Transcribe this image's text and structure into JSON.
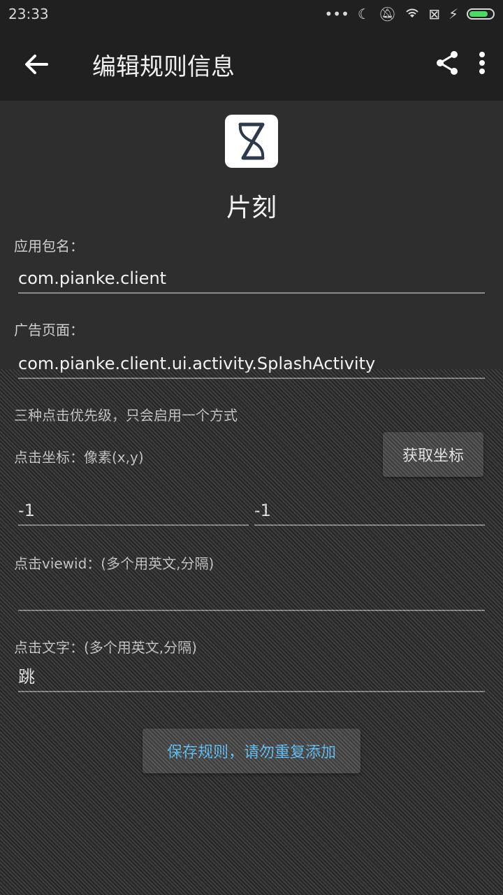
{
  "status_bar": {
    "time": "23:33",
    "icons": [
      "more-dots-icon",
      "moon-icon",
      "bell-off-icon",
      "wifi-icon",
      "sim-x-icon",
      "charging-icon",
      "battery-icon"
    ]
  },
  "app_bar": {
    "title": "编辑规则信息",
    "icons": [
      "back-arrow-icon",
      "share-icon",
      "more-vert-icon"
    ]
  },
  "app": {
    "name": "片刻",
    "icon": "hourglass-logo-icon"
  },
  "form": {
    "package_label": "应用包名：",
    "package_value": "com.pianke.client",
    "ad_page_label": "广告页面：",
    "ad_page_value": "com.pianke.client.ui.activity.SplashActivity",
    "hint": "三种点击优先级，只会启用一个方式",
    "coord_label": "点击坐标：像素(x,y)",
    "coord_button": "获取坐标",
    "x_value": "-1",
    "y_value": "-1",
    "viewid_label": "点击viewid：(多个用英文,分隔)",
    "viewid_value": "",
    "text_label": "点击文字：(多个用英文,分隔)",
    "text_value": "跳",
    "save_button": "保存规则，请勿重复添加"
  },
  "colors": {
    "background": "#2e2e2e",
    "app_bar": "#202020",
    "accent": "#62c8ff",
    "battery": "#4cd964"
  }
}
